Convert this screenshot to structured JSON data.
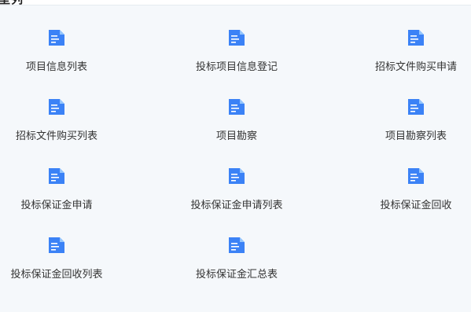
{
  "header": {
    "title": "型列"
  },
  "colors": {
    "background": "#f5f8fb",
    "icon_blue": "#3b82f6",
    "text": "#333333"
  },
  "tiles": [
    {
      "label": "项目信息列表",
      "icon": "document-icon"
    },
    {
      "label": "投标项目信息登记",
      "icon": "document-icon"
    },
    {
      "label": "招标文件购买申请",
      "icon": "document-icon"
    },
    {
      "label": "招标文件购买列表",
      "icon": "document-icon"
    },
    {
      "label": "项目勘察",
      "icon": "document-icon"
    },
    {
      "label": "项目勘察列表",
      "icon": "document-icon"
    },
    {
      "label": "投标保证金申请",
      "icon": "document-icon"
    },
    {
      "label": "投标保证金申请列表",
      "icon": "document-icon"
    },
    {
      "label": "投标保证金回收",
      "icon": "document-icon"
    },
    {
      "label": "投标保证金回收列表",
      "icon": "document-icon"
    },
    {
      "label": "投标保证金汇总表",
      "icon": "document-icon"
    }
  ]
}
